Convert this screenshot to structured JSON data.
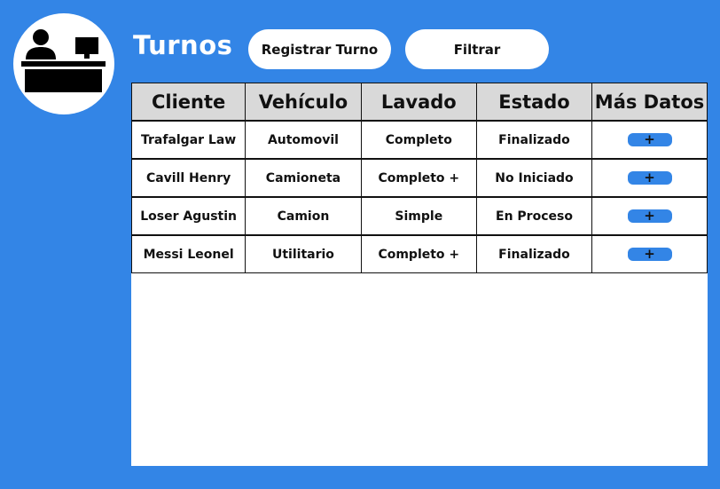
{
  "header": {
    "title": "Turnos",
    "register_button": "Registrar Turno",
    "filter_button": "Filtrar"
  },
  "logo": {
    "icon": "receptionist-desk-icon"
  },
  "table": {
    "columns": [
      "Cliente",
      "Vehículo",
      "Lavado",
      "Estado",
      "Más Datos"
    ],
    "rows": [
      {
        "client": "Trafalgar Law",
        "vehicle": "Automovil",
        "wash": "Completo",
        "status": "Finalizado",
        "more": "+"
      },
      {
        "client": "Cavill Henry",
        "vehicle": "Camioneta",
        "wash": "Completo +",
        "status": "No Iniciado",
        "more": "+"
      },
      {
        "client": "Loser Agustin",
        "vehicle": "Camion",
        "wash": "Simple",
        "status": "En Proceso",
        "more": "+"
      },
      {
        "client": "Messi Leonel",
        "vehicle": "Utilitario",
        "wash": "Completo +",
        "status": "Finalizado",
        "more": "+"
      }
    ]
  },
  "colors": {
    "background": "#3385e6",
    "panel": "#ffffff",
    "header_row": "#d9d9d9",
    "accent_button": "#3385e6"
  }
}
